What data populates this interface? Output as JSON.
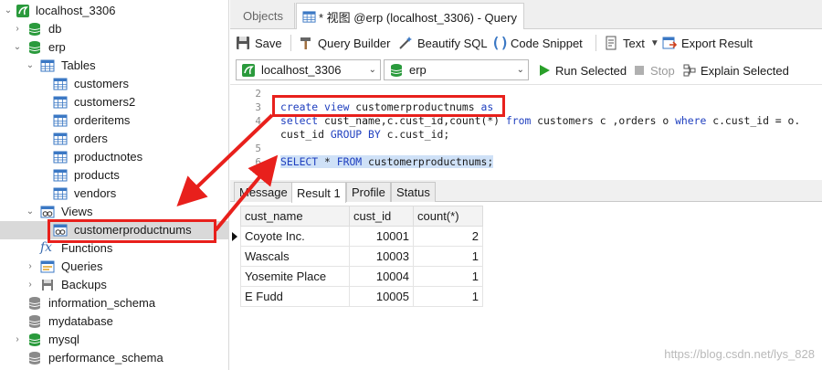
{
  "navigator": {
    "connection": "localhost_3306",
    "databases": [
      {
        "name": "db"
      },
      {
        "name": "erp"
      }
    ],
    "erp_children": {
      "tables_label": "Tables",
      "tables": [
        "customers",
        "customers2",
        "orderitems",
        "orders",
        "productnotes",
        "products",
        "vendors"
      ],
      "views_label": "Views",
      "views": [
        "customerproductnums"
      ],
      "functions_label": "Functions",
      "queries_label": "Queries",
      "backups_label": "Backups"
    },
    "other_databases": [
      "information_schema",
      "mydatabase",
      "mysql",
      "performance_schema"
    ]
  },
  "tabs": {
    "objects": "Objects",
    "query": "* 视图 @erp (localhost_3306) - Query"
  },
  "toolbar": {
    "save": "Save",
    "query_builder": "Query Builder",
    "beautify_sql": "Beautify SQL",
    "code_snippet": "Code Snippet",
    "text": "Text",
    "export_result": "Export Result"
  },
  "connbar": {
    "connection": "localhost_3306",
    "database": "erp",
    "run_selected": "Run Selected",
    "stop": "Stop",
    "explain_selected": "Explain Selected"
  },
  "editor": {
    "line_numbers": [
      "2",
      "3",
      "4",
      "5",
      "6"
    ],
    "lines": [
      "",
      "create view customerproductnums as",
      "select cust_name,c.cust_id,count(*) from customers c ,orders o where c.cust_id = o.",
      "cust_id GROUP BY c.cust_id;",
      "",
      "SELECT * FROM customerproductnums;"
    ]
  },
  "result_tabs": [
    "Message",
    "Result 1",
    "Profile",
    "Status"
  ],
  "result": {
    "columns": [
      "cust_name",
      "cust_id",
      "count(*)"
    ],
    "rows": [
      [
        "Coyote Inc.",
        "10001",
        "2"
      ],
      [
        "Wascals",
        "10003",
        "1"
      ],
      [
        "Yosemite Place",
        "10004",
        "1"
      ],
      [
        "E Fudd",
        "10005",
        "1"
      ]
    ]
  },
  "watermark": "https://blog.csdn.net/lys_828",
  "colors": {
    "keyword": "#1f3fbf",
    "annotation_red": "#e8201c",
    "db_green": "#2a9a3c",
    "selection": "#d9d9d9"
  }
}
